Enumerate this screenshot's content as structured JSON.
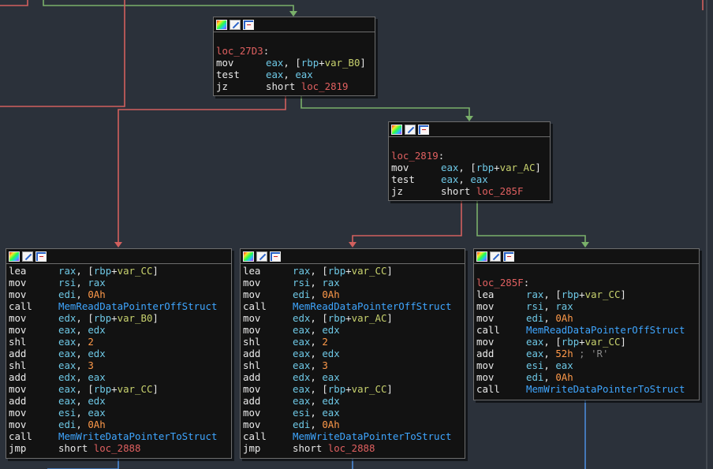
{
  "graph": {
    "colors": {
      "background": "#2b313a",
      "node_fill": "#121212",
      "edge_true": "#7ab06a",
      "edge_false": "#d2605e",
      "edge_plain": "#4a8ad8"
    },
    "nodes": [
      {
        "id": "loc_27D3",
        "label": "loc_27D3",
        "lines": [
          {
            "m": "mov",
            "o": [
              {
                "t": "eax",
                "k": "reg"
              },
              {
                "t": ", [",
                "k": "p"
              },
              {
                "t": "rbp",
                "k": "reg"
              },
              {
                "t": "+",
                "k": "p"
              },
              {
                "t": "var_B0",
                "k": "var"
              },
              {
                "t": "]",
                "k": "p"
              }
            ]
          },
          {
            "m": "test",
            "o": [
              {
                "t": "eax",
                "k": "reg"
              },
              {
                "t": ", ",
                "k": "p"
              },
              {
                "t": "eax",
                "k": "reg"
              }
            ]
          },
          {
            "m": "jz",
            "o": [
              {
                "t": "short ",
                "k": "p"
              },
              {
                "t": "loc_2819",
                "k": "loc"
              }
            ]
          }
        ]
      },
      {
        "id": "loc_2819",
        "label": "loc_2819",
        "lines": [
          {
            "m": "mov",
            "o": [
              {
                "t": "eax",
                "k": "reg"
              },
              {
                "t": ", [",
                "k": "p"
              },
              {
                "t": "rbp",
                "k": "reg"
              },
              {
                "t": "+",
                "k": "p"
              },
              {
                "t": "var_AC",
                "k": "var"
              },
              {
                "t": "]",
                "k": "p"
              }
            ]
          },
          {
            "m": "test",
            "o": [
              {
                "t": "eax",
                "k": "reg"
              },
              {
                "t": ", ",
                "k": "p"
              },
              {
                "t": "eax",
                "k": "reg"
              }
            ]
          },
          {
            "m": "jz",
            "o": [
              {
                "t": "short ",
                "k": "p"
              },
              {
                "t": "loc_285F",
                "k": "loc"
              }
            ]
          }
        ]
      },
      {
        "id": "block_b0",
        "label": "",
        "lines": [
          {
            "m": "lea",
            "o": [
              {
                "t": "rax",
                "k": "reg"
              },
              {
                "t": ", [",
                "k": "p"
              },
              {
                "t": "rbp",
                "k": "reg"
              },
              {
                "t": "+",
                "k": "p"
              },
              {
                "t": "var_CC",
                "k": "var"
              },
              {
                "t": "]",
                "k": "p"
              }
            ]
          },
          {
            "m": "mov",
            "o": [
              {
                "t": "rsi",
                "k": "reg"
              },
              {
                "t": ", ",
                "k": "p"
              },
              {
                "t": "rax",
                "k": "reg"
              }
            ]
          },
          {
            "m": "mov",
            "o": [
              {
                "t": "edi",
                "k": "reg"
              },
              {
                "t": ", ",
                "k": "p"
              },
              {
                "t": "0Ah",
                "k": "num"
              }
            ]
          },
          {
            "m": "call",
            "o": [
              {
                "t": "MemReadDataPointerOffStruct",
                "k": "func"
              }
            ]
          },
          {
            "m": "mov",
            "o": [
              {
                "t": "edx",
                "k": "reg"
              },
              {
                "t": ", [",
                "k": "p"
              },
              {
                "t": "rbp",
                "k": "reg"
              },
              {
                "t": "+",
                "k": "p"
              },
              {
                "t": "var_B0",
                "k": "var"
              },
              {
                "t": "]",
                "k": "p"
              }
            ]
          },
          {
            "m": "mov",
            "o": [
              {
                "t": "eax",
                "k": "reg"
              },
              {
                "t": ", ",
                "k": "p"
              },
              {
                "t": "edx",
                "k": "reg"
              }
            ]
          },
          {
            "m": "shl",
            "o": [
              {
                "t": "eax",
                "k": "reg"
              },
              {
                "t": ", ",
                "k": "p"
              },
              {
                "t": "2",
                "k": "num"
              }
            ]
          },
          {
            "m": "add",
            "o": [
              {
                "t": "eax",
                "k": "reg"
              },
              {
                "t": ", ",
                "k": "p"
              },
              {
                "t": "edx",
                "k": "reg"
              }
            ]
          },
          {
            "m": "shl",
            "o": [
              {
                "t": "eax",
                "k": "reg"
              },
              {
                "t": ", ",
                "k": "p"
              },
              {
                "t": "3",
                "k": "num"
              }
            ]
          },
          {
            "m": "add",
            "o": [
              {
                "t": "edx",
                "k": "reg"
              },
              {
                "t": ", ",
                "k": "p"
              },
              {
                "t": "eax",
                "k": "reg"
              }
            ]
          },
          {
            "m": "mov",
            "o": [
              {
                "t": "eax",
                "k": "reg"
              },
              {
                "t": ", [",
                "k": "p"
              },
              {
                "t": "rbp",
                "k": "reg"
              },
              {
                "t": "+",
                "k": "p"
              },
              {
                "t": "var_CC",
                "k": "var"
              },
              {
                "t": "]",
                "k": "p"
              }
            ]
          },
          {
            "m": "add",
            "o": [
              {
                "t": "eax",
                "k": "reg"
              },
              {
                "t": ", ",
                "k": "p"
              },
              {
                "t": "edx",
                "k": "reg"
              }
            ]
          },
          {
            "m": "mov",
            "o": [
              {
                "t": "esi",
                "k": "reg"
              },
              {
                "t": ", ",
                "k": "p"
              },
              {
                "t": "eax",
                "k": "reg"
              }
            ]
          },
          {
            "m": "mov",
            "o": [
              {
                "t": "edi",
                "k": "reg"
              },
              {
                "t": ", ",
                "k": "p"
              },
              {
                "t": "0Ah",
                "k": "num"
              }
            ]
          },
          {
            "m": "call",
            "o": [
              {
                "t": "MemWriteDataPointerToStruct",
                "k": "func"
              }
            ]
          },
          {
            "m": "jmp",
            "o": [
              {
                "t": "short ",
                "k": "p"
              },
              {
                "t": "loc_2888",
                "k": "loc"
              }
            ]
          }
        ]
      },
      {
        "id": "block_ac",
        "label": "",
        "lines": [
          {
            "m": "lea",
            "o": [
              {
                "t": "rax",
                "k": "reg"
              },
              {
                "t": ", [",
                "k": "p"
              },
              {
                "t": "rbp",
                "k": "reg"
              },
              {
                "t": "+",
                "k": "p"
              },
              {
                "t": "var_CC",
                "k": "var"
              },
              {
                "t": "]",
                "k": "p"
              }
            ]
          },
          {
            "m": "mov",
            "o": [
              {
                "t": "rsi",
                "k": "reg"
              },
              {
                "t": ", ",
                "k": "p"
              },
              {
                "t": "rax",
                "k": "reg"
              }
            ]
          },
          {
            "m": "mov",
            "o": [
              {
                "t": "edi",
                "k": "reg"
              },
              {
                "t": ", ",
                "k": "p"
              },
              {
                "t": "0Ah",
                "k": "num"
              }
            ]
          },
          {
            "m": "call",
            "o": [
              {
                "t": "MemReadDataPointerOffStruct",
                "k": "func"
              }
            ]
          },
          {
            "m": "mov",
            "o": [
              {
                "t": "edx",
                "k": "reg"
              },
              {
                "t": ", [",
                "k": "p"
              },
              {
                "t": "rbp",
                "k": "reg"
              },
              {
                "t": "+",
                "k": "p"
              },
              {
                "t": "var_AC",
                "k": "var"
              },
              {
                "t": "]",
                "k": "p"
              }
            ]
          },
          {
            "m": "mov",
            "o": [
              {
                "t": "eax",
                "k": "reg"
              },
              {
                "t": ", ",
                "k": "p"
              },
              {
                "t": "edx",
                "k": "reg"
              }
            ]
          },
          {
            "m": "shl",
            "o": [
              {
                "t": "eax",
                "k": "reg"
              },
              {
                "t": ", ",
                "k": "p"
              },
              {
                "t": "2",
                "k": "num"
              }
            ]
          },
          {
            "m": "add",
            "o": [
              {
                "t": "eax",
                "k": "reg"
              },
              {
                "t": ", ",
                "k": "p"
              },
              {
                "t": "edx",
                "k": "reg"
              }
            ]
          },
          {
            "m": "shl",
            "o": [
              {
                "t": "eax",
                "k": "reg"
              },
              {
                "t": ", ",
                "k": "p"
              },
              {
                "t": "3",
                "k": "num"
              }
            ]
          },
          {
            "m": "add",
            "o": [
              {
                "t": "edx",
                "k": "reg"
              },
              {
                "t": ", ",
                "k": "p"
              },
              {
                "t": "eax",
                "k": "reg"
              }
            ]
          },
          {
            "m": "mov",
            "o": [
              {
                "t": "eax",
                "k": "reg"
              },
              {
                "t": ", [",
                "k": "p"
              },
              {
                "t": "rbp",
                "k": "reg"
              },
              {
                "t": "+",
                "k": "p"
              },
              {
                "t": "var_CC",
                "k": "var"
              },
              {
                "t": "]",
                "k": "p"
              }
            ]
          },
          {
            "m": "add",
            "o": [
              {
                "t": "eax",
                "k": "reg"
              },
              {
                "t": ", ",
                "k": "p"
              },
              {
                "t": "edx",
                "k": "reg"
              }
            ]
          },
          {
            "m": "mov",
            "o": [
              {
                "t": "esi",
                "k": "reg"
              },
              {
                "t": ", ",
                "k": "p"
              },
              {
                "t": "eax",
                "k": "reg"
              }
            ]
          },
          {
            "m": "mov",
            "o": [
              {
                "t": "edi",
                "k": "reg"
              },
              {
                "t": ", ",
                "k": "p"
              },
              {
                "t": "0Ah",
                "k": "num"
              }
            ]
          },
          {
            "m": "call",
            "o": [
              {
                "t": "MemWriteDataPointerToStruct",
                "k": "func"
              }
            ]
          },
          {
            "m": "jmp",
            "o": [
              {
                "t": "short ",
                "k": "p"
              },
              {
                "t": "loc_2888",
                "k": "loc"
              }
            ]
          }
        ]
      },
      {
        "id": "loc_285F",
        "label": "loc_285F",
        "lines": [
          {
            "m": "lea",
            "o": [
              {
                "t": "rax",
                "k": "reg"
              },
              {
                "t": ", [",
                "k": "p"
              },
              {
                "t": "rbp",
                "k": "reg"
              },
              {
                "t": "+",
                "k": "p"
              },
              {
                "t": "var_CC",
                "k": "var"
              },
              {
                "t": "]",
                "k": "p"
              }
            ]
          },
          {
            "m": "mov",
            "o": [
              {
                "t": "rsi",
                "k": "reg"
              },
              {
                "t": ", ",
                "k": "p"
              },
              {
                "t": "rax",
                "k": "reg"
              }
            ]
          },
          {
            "m": "mov",
            "o": [
              {
                "t": "edi",
                "k": "reg"
              },
              {
                "t": ", ",
                "k": "p"
              },
              {
                "t": "0Ah",
                "k": "num"
              }
            ]
          },
          {
            "m": "call",
            "o": [
              {
                "t": "MemReadDataPointerOffStruct",
                "k": "func"
              }
            ]
          },
          {
            "m": "mov",
            "o": [
              {
                "t": "eax",
                "k": "reg"
              },
              {
                "t": ", [",
                "k": "p"
              },
              {
                "t": "rbp",
                "k": "reg"
              },
              {
                "t": "+",
                "k": "p"
              },
              {
                "t": "var_CC",
                "k": "var"
              },
              {
                "t": "]",
                "k": "p"
              }
            ]
          },
          {
            "m": "add",
            "o": [
              {
                "t": "eax",
                "k": "reg"
              },
              {
                "t": ", ",
                "k": "p"
              },
              {
                "t": "52h",
                "k": "num"
              },
              {
                "t": " ; 'R'",
                "k": "cmt"
              }
            ]
          },
          {
            "m": "mov",
            "o": [
              {
                "t": "esi",
                "k": "reg"
              },
              {
                "t": ", ",
                "k": "p"
              },
              {
                "t": "eax",
                "k": "reg"
              }
            ]
          },
          {
            "m": "mov",
            "o": [
              {
                "t": "edi",
                "k": "reg"
              },
              {
                "t": ", ",
                "k": "p"
              },
              {
                "t": "0Ah",
                "k": "num"
              }
            ]
          },
          {
            "m": "call",
            "o": [
              {
                "t": "MemWriteDataPointerToStruct",
                "k": "func"
              }
            ]
          }
        ]
      }
    ]
  }
}
